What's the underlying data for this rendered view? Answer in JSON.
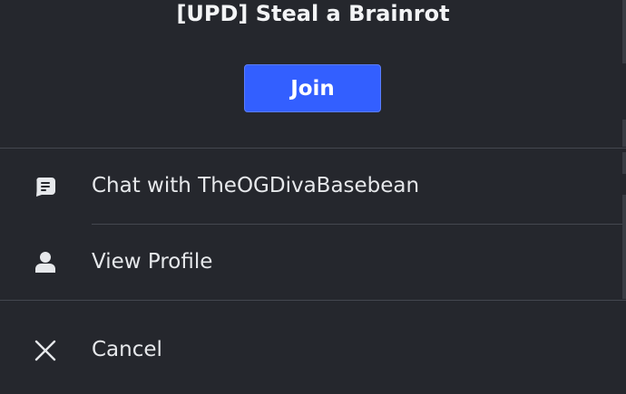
{
  "game": {
    "title": "[UPD] Steal a Brainrot"
  },
  "actions": {
    "join_label": "Join"
  },
  "menu": {
    "items": [
      {
        "label": "Chat with TheOGDivaBasebean",
        "icon": "chat-icon"
      },
      {
        "label": "View Profile",
        "icon": "profile-icon"
      },
      {
        "label": "Cancel",
        "icon": "close-icon"
      }
    ]
  },
  "colors": {
    "background": "#25272d",
    "accent": "#335fff",
    "divider": "#44474f",
    "text": "#e6e8eb"
  }
}
